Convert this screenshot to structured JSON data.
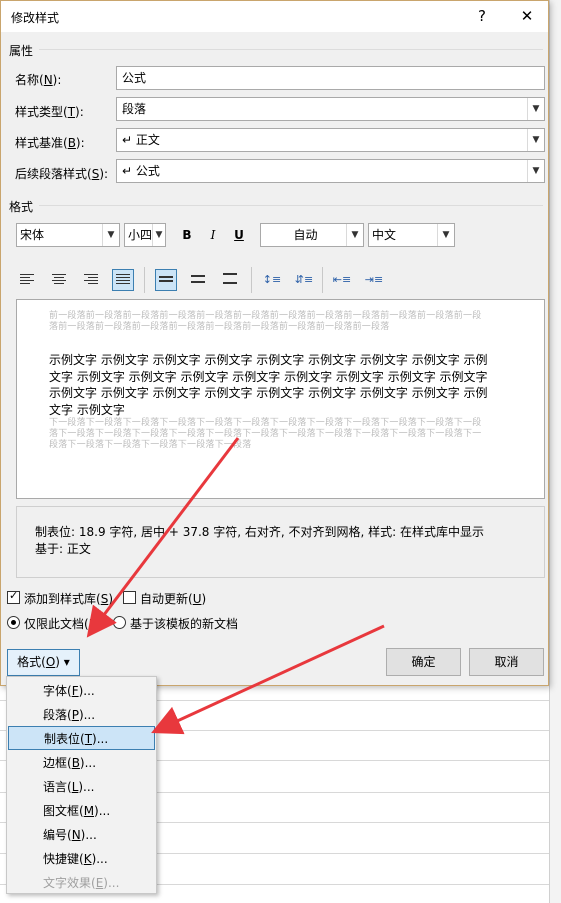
{
  "dialog": {
    "title": "修改样式",
    "help": "?",
    "close": "✕"
  },
  "properties": {
    "section": "属性",
    "name_label": "名称(N):",
    "name_value": "公式",
    "type_label": "样式类型(T):",
    "type_value": "段落",
    "based_label": "样式基准(B):",
    "based_value": "↵ 正文",
    "next_label": "后续段落样式(S):",
    "next_value": "↵ 公式"
  },
  "format": {
    "section": "格式",
    "font": "宋体",
    "size": "小四",
    "bold": "B",
    "italic": "I",
    "underline": "U",
    "color": "自动",
    "script": "中文"
  },
  "preview": {
    "prev_para": "前一段落前一段落前一段落前一段落前一段落前一段落前一段落前一段落前一段落前一段落前一段落前一段落前一段落前一段落前一段落前一段落前一段落前一段落前一段落前一段落前一段落",
    "sample": "示例文字 示例文字 示例文字 示例文字 示例文字 示例文字 示例文字 示例文字 示例文字 示例文字 示例文字 示例文字 示例文字 示例文字 示例文字 示例文字 示例文字 示例文字 示例文字 示例文字 示例文字 示例文字 示例文字 示例文字 示例文字 示例文字 示例文字",
    "next_para": "下一段落下一段落下一段落下一段落下一段落下一段落下一段落下一段落下一段落下一段落下一段落下一段落下一段落下一段落下一段落下一段落下一段落下一段落下一段落下一段落下一段落下一段落下一段落下一段落下一段落下一段落下一段落下一段落下一段落"
  },
  "description": {
    "line1": "制表位:  18.9 字符, 居中 +  37.8 字符, 右对齐, 不对齐到网格, 样式: 在样式库中显示",
    "line2": "基于: 正文"
  },
  "options": {
    "add_to_gallery": "添加到样式库(S)",
    "auto_update": "自动更新(U)",
    "this_doc_only": "仅限此文档(D)",
    "new_docs": "基于该模板的新文档"
  },
  "buttons": {
    "format": "格式(O) ▾",
    "ok": "确定",
    "cancel": "取消"
  },
  "menu": {
    "items": [
      "字体(F)...",
      "段落(P)...",
      "制表位(T)...",
      "边框(B)...",
      "语言(L)...",
      "图文框(M)...",
      "编号(N)...",
      "快捷键(K)...",
      "文字效果(E)..."
    ]
  },
  "colors": {
    "accent_highlight": "#cce4f7",
    "accent_border": "#3c7fb1",
    "arrow": "#e8383d"
  }
}
